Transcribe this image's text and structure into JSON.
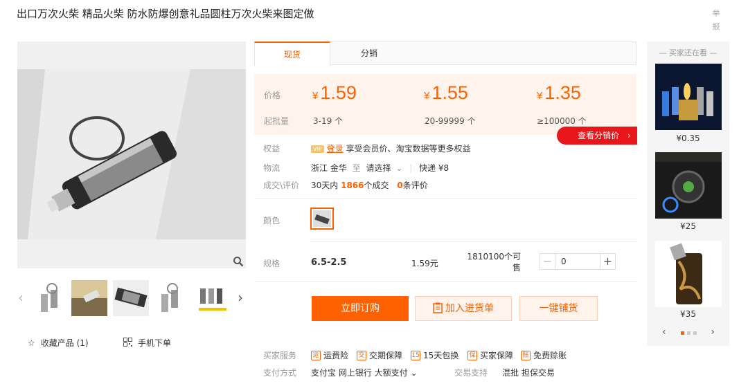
{
  "product": {
    "title": "出口万次火柴 精品火柴 防水防爆创意礼品圆柱万次火柴来图定做",
    "report_label": "举报"
  },
  "gallery": {
    "favorite_label": "收藏产品 (1)",
    "mobile_order_label": "手机下单"
  },
  "tabs": [
    {
      "label": "现货"
    },
    {
      "label": "分销"
    }
  ],
  "pricing": {
    "price_label": "价格",
    "min_qty_label": "起批量",
    "currency": "¥",
    "tiers": [
      {
        "price": "1.59",
        "qty": "3-19 个"
      },
      {
        "price": "1.55",
        "qty": "20-99999 个"
      },
      {
        "price": "1.35",
        "qty": "≥100000 个"
      }
    ],
    "see_dist_price": "查看分销价"
  },
  "benefits": {
    "label": "权益",
    "vip_badge": "VIP",
    "login_link": "登录",
    "text": "享受会员价、淘宝数据等更多权益"
  },
  "logistics": {
    "label": "物流",
    "from": "浙江 金华",
    "to_word": "至",
    "select": "请选择",
    "express": "快递 ¥8"
  },
  "deals": {
    "label": "成交\\评价",
    "prefix": "30天内",
    "count": "1866",
    "count_suffix": "个成交",
    "reviews": "0",
    "reviews_suffix": "条评价"
  },
  "color": {
    "label": "颜色"
  },
  "spec": {
    "label": "规格",
    "name": "6.5-2.5",
    "price": "1.59元",
    "stock_line1": "1810100个可",
    "stock_line2": "售",
    "quantity": "0"
  },
  "actions": {
    "order": "立即订购",
    "cart": "加入进货单",
    "distribute": "一键铺货"
  },
  "services": {
    "label": "买家服务",
    "items": [
      {
        "icon": "运",
        "label": "运费险"
      },
      {
        "icon": "交",
        "label": "交期保障"
      },
      {
        "icon": "15",
        "label": "15天包换"
      },
      {
        "icon": "保",
        "label": "买家保障"
      },
      {
        "icon": "账",
        "label": "免费赊账"
      }
    ]
  },
  "payment": {
    "label": "支付方式",
    "methods": "支付宝  网上银行  大额支付",
    "trade_label": "交易支持",
    "trade_values": "混批  担保交易"
  },
  "sidebar": {
    "heading": "买家还在看",
    "items": [
      {
        "price": "¥0.35"
      },
      {
        "price": "¥25"
      },
      {
        "price": "¥35"
      }
    ]
  },
  "colors": {
    "accent": "#ff6000",
    "red_tag": "#e8151a",
    "panel_bg": "#fff3ec"
  }
}
